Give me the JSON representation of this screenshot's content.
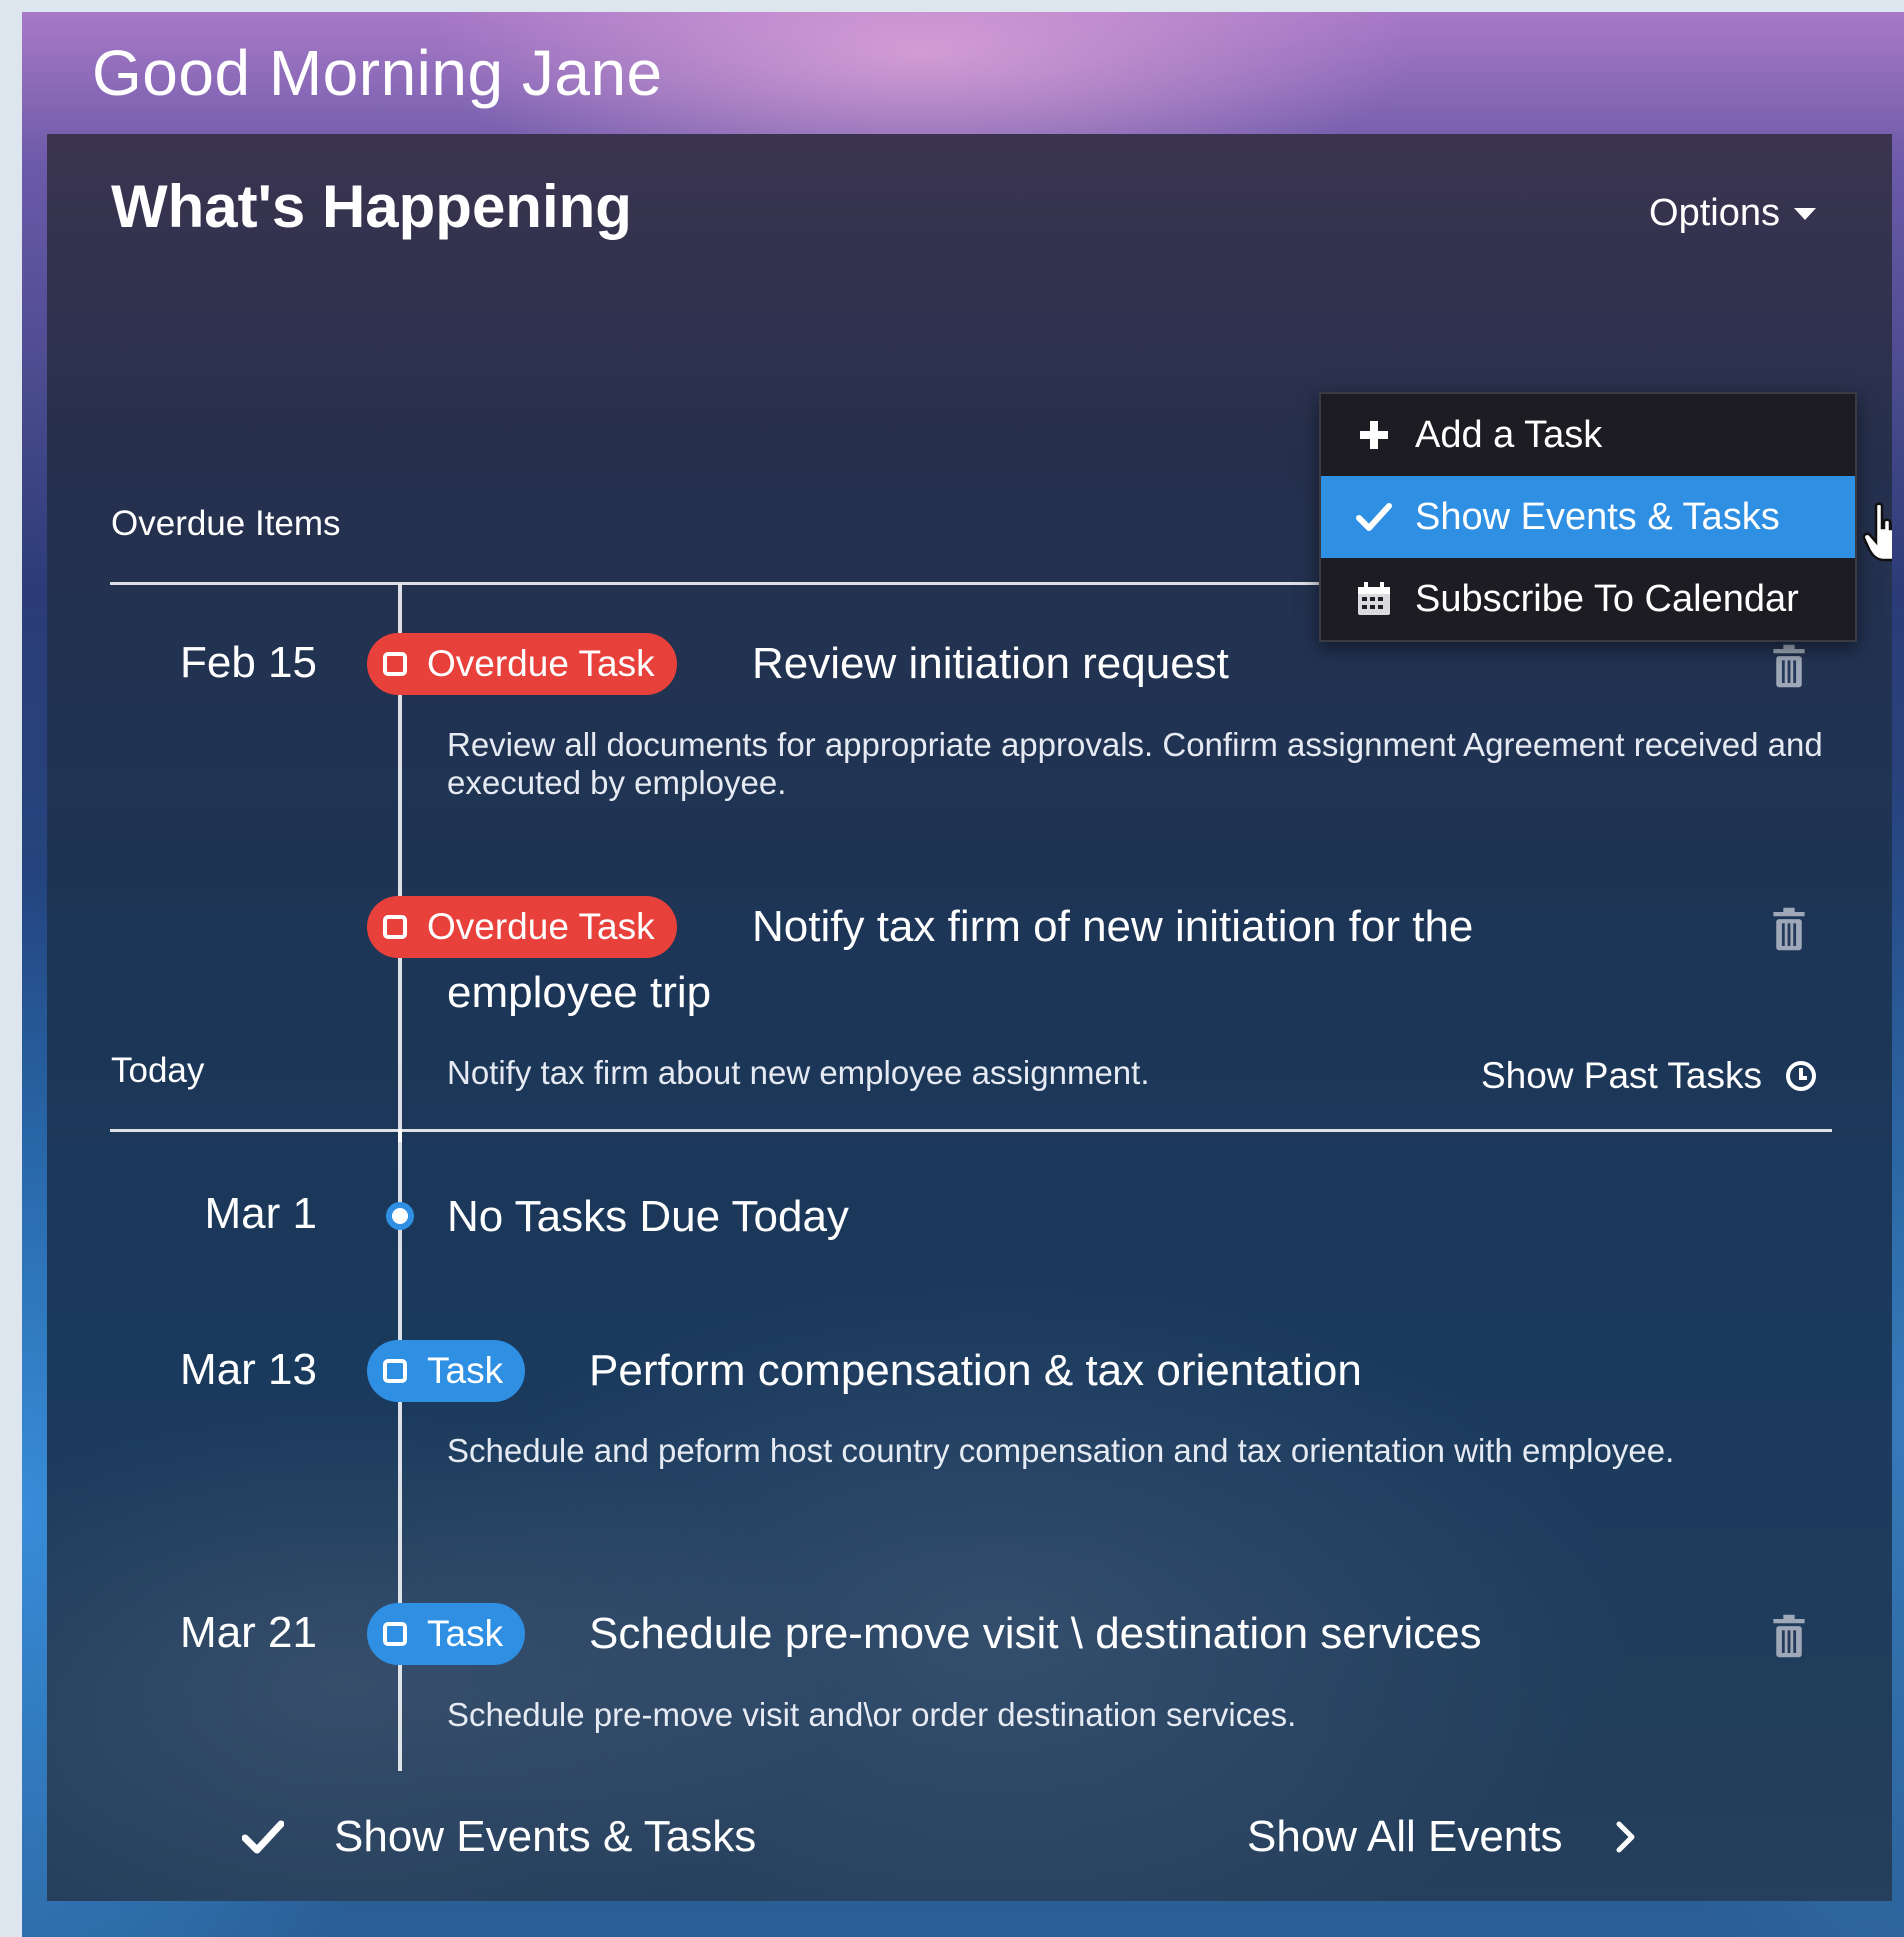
{
  "greeting": "Good Morning Jane",
  "card": {
    "title": "What's Happening",
    "options_label": "Options"
  },
  "options_menu": {
    "items": [
      {
        "label": "Add a Task",
        "icon": "plus-icon",
        "active": false
      },
      {
        "label": "Show Events & Tasks",
        "icon": "check-icon",
        "active": true
      },
      {
        "label": "Subscribe To Calendar",
        "icon": "calendar-icon",
        "active": false
      }
    ]
  },
  "overdue_section": {
    "label": "Overdue Items",
    "items": [
      {
        "date": "Feb 15",
        "badge": "Overdue Task",
        "title": "Review initiation request",
        "description": "Review all documents for appropriate approvals. Confirm assignment Agreement received and executed by employee."
      },
      {
        "date": "",
        "badge": "Overdue Task",
        "title_line1": "Notify tax firm of new initiation for the",
        "title_line2": "employee trip",
        "description": "Notify tax firm about new employee assignment."
      }
    ]
  },
  "today_section": {
    "label": "Today",
    "show_past_label": "Show Past Tasks",
    "items": [
      {
        "date": "Mar 1",
        "title": "No Tasks Due Today"
      },
      {
        "date": "Mar 13",
        "badge": "Task",
        "title": "Perform compensation & tax orientation",
        "description": "Schedule and peform host country compensation and tax orientation with employee."
      },
      {
        "date": "Mar 21",
        "badge": "Task",
        "title": "Schedule pre-move visit \\ destination services",
        "description": "Schedule pre-move visit and\\or order destination services."
      }
    ]
  },
  "footer": {
    "left_label": "Show Events & Tasks",
    "right_label": "Show All Events"
  },
  "colors": {
    "overdue": "#e8403b",
    "task": "#2f8fe3",
    "menu_active": "#2f8fe3"
  }
}
